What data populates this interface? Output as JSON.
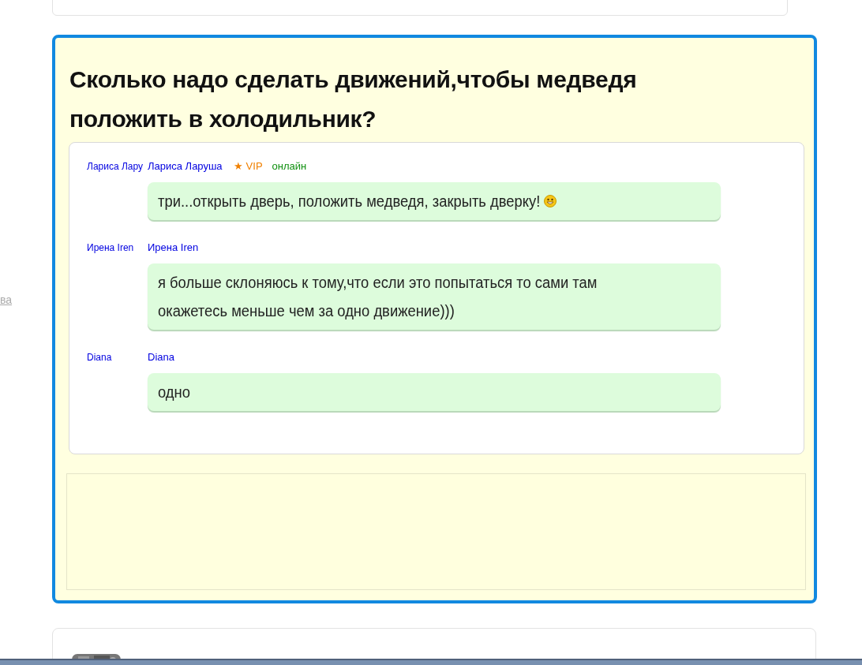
{
  "side_link": "ва",
  "question": {
    "title": "Сколько надо сделать движений,чтобы медведя положить в холодильник?",
    "answers": [
      {
        "author_short": "Лариса Лару",
        "author": "Лариса Ларуша",
        "vip_star": "★",
        "vip_label": "VIP",
        "online_label": "онлайн",
        "text": "три...открыть дверь, положить медведя, закрыть дверку!",
        "smiley": true
      },
      {
        "author_short": "Ирена Iren",
        "author": "Ирена Iren",
        "text": "я больше склоняюсь к тому,что если это попытаться то сами там окажетесь меньше чем за одно движение)))"
      },
      {
        "author_short": "Diana",
        "author": "Diana",
        "text": "одно"
      }
    ]
  }
}
